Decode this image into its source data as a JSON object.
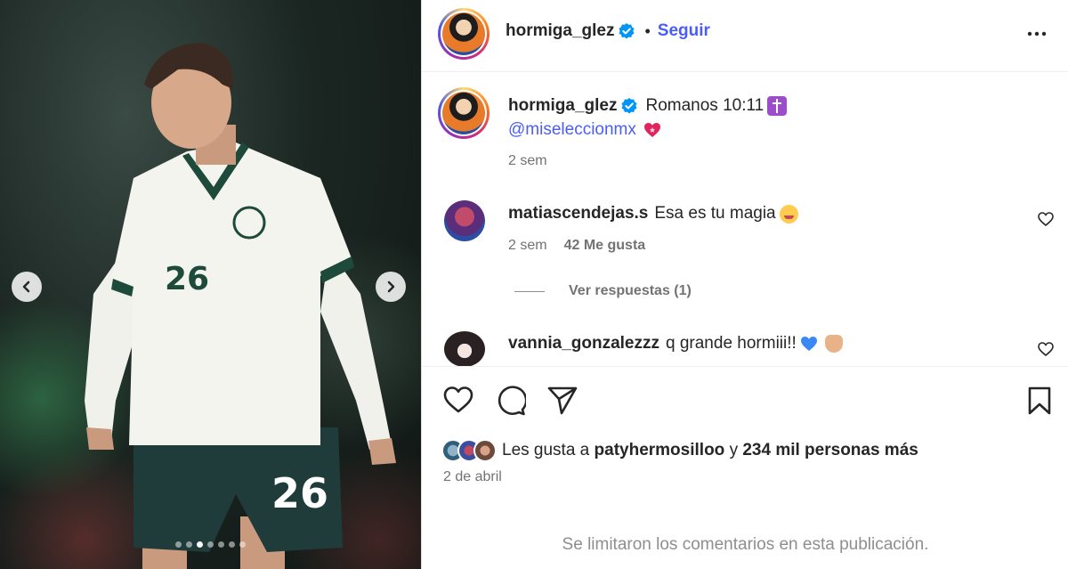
{
  "post": {
    "author": "hormiga_glez",
    "follow_label": "Seguir",
    "separator": "•",
    "caption_text": "Romanos 10:11",
    "mention": "@miseleccionmx",
    "caption_time": "2 sem"
  },
  "carousel": {
    "total_slides": 7,
    "active_index": 2
  },
  "comments": [
    {
      "user": "matiascendejas.s",
      "text": "Esa es tu magia",
      "time": "2 sem",
      "likes": "42 Me gusta",
      "replies_label": "Ver respuestas (1)"
    },
    {
      "user": "vannia_gonzalezzz",
      "text": "q grande hormiii!!"
    }
  ],
  "likes": {
    "prefix": "Les gusta a",
    "user": "patyhermosilloo",
    "connector": "y",
    "count_text": "234 mil personas más"
  },
  "date": "2 de abril",
  "comments_limited": "Se limitaron los comentarios en esta publicación.",
  "colors": {
    "link_blue": "#4a5df9",
    "verified_blue": "#0095f6",
    "secondary_text": "#737373"
  },
  "icons": [
    "chevron-left-icon",
    "chevron-right-icon",
    "verified-icon",
    "more-icon",
    "heart-icon",
    "comment-icon",
    "share-icon",
    "bookmark-icon"
  ]
}
